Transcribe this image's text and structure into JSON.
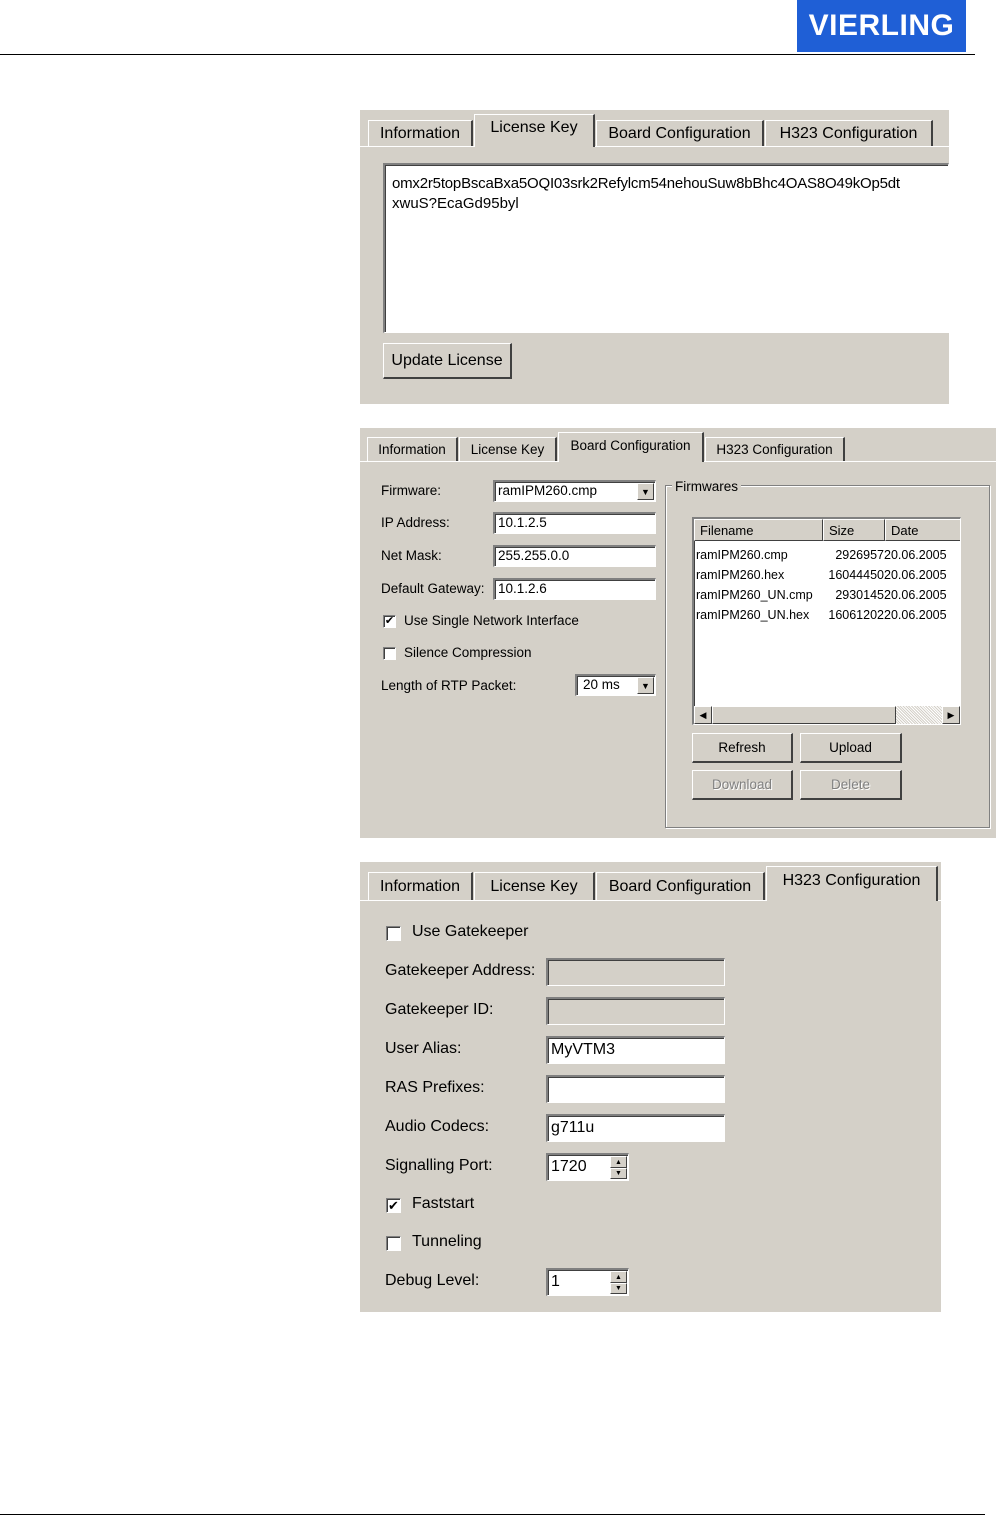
{
  "brand": {
    "logo_text": "VIERLING",
    "logo_color": "#1f5fd6"
  },
  "tabs": [
    "Information",
    "License Key",
    "Board Configuration",
    "H323 Configuration"
  ],
  "license_panel": {
    "active_tab": "License Key",
    "key_line1": "omx2r5topBscaBxa5OQI03srk2Refylcm54nehouSuw8bBhc4OAS8O49kOp5dt",
    "key_line2": "xwuS?EcaGd95byl",
    "update_button": "Update License"
  },
  "board_panel": {
    "active_tab": "Board Configuration",
    "firmware_label": "Firmware:",
    "firmware_value": "ramIPM260.cmp",
    "ip_label": "IP Address:",
    "ip_value": "10.1.2.5",
    "mask_label": "Net Mask:",
    "mask_value": "255.255.0.0",
    "gateway_label": "Default Gateway:",
    "gateway_value": "10.1.2.6",
    "single_if_label": "Use Single Network Interface",
    "single_if_checked": true,
    "silence_label": "Silence Compression",
    "silence_checked": false,
    "rtp_label": "Length of RTP Packet:",
    "rtp_value": "20 ms",
    "firmwares_group": "Firmwares",
    "columns": [
      "Filename",
      "Size",
      "Date"
    ],
    "rows": [
      {
        "name": "ramIPM260.cmp",
        "size": "2926957",
        "date": "20.06.2005"
      },
      {
        "name": "ramIPM260.hex",
        "size": "16044450",
        "date": "20.06.2005"
      },
      {
        "name": "ramIPM260_UN.cmp",
        "size": "2930145",
        "date": "20.06.2005"
      },
      {
        "name": "ramIPM260_UN.hex",
        "size": "16061202",
        "date": "20.06.2005"
      }
    ],
    "refresh_button": "Refresh",
    "upload_button": "Upload",
    "download_button": "Download",
    "delete_button": "Delete"
  },
  "h323_panel": {
    "active_tab": "H323 Configuration",
    "use_gk_label": "Use Gatekeeper",
    "use_gk_checked": false,
    "gk_address_label": "Gatekeeper Address:",
    "gk_address_value": "",
    "gk_id_label": "Gatekeeper ID:",
    "gk_id_value": "",
    "alias_label": "User Alias:",
    "alias_value": "MyVTM3",
    "ras_label": "RAS Prefixes:",
    "ras_value": "",
    "codecs_label": "Audio Codecs:",
    "codecs_value": "g711u",
    "port_label": "Signalling Port:",
    "port_value": "1720",
    "faststart_label": "Faststart",
    "faststart_checked": true,
    "tunneling_label": "Tunneling",
    "tunneling_checked": false,
    "debug_label": "Debug Level:",
    "debug_value": "1"
  }
}
